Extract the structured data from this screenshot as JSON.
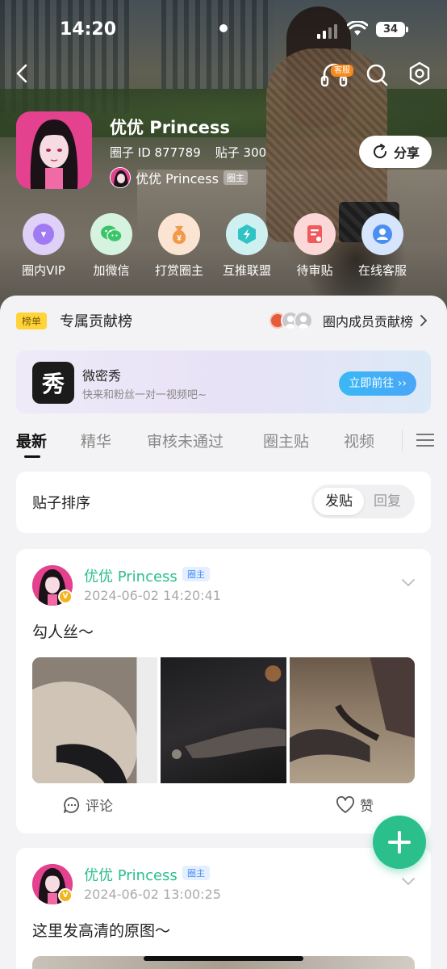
{
  "status_bar": {
    "time": "14:20",
    "battery": "34"
  },
  "nav": {
    "headset_badge": "客服"
  },
  "profile": {
    "name": "优优 Princess",
    "circle_id": "圈子 ID 877789",
    "posts": "贴子 300",
    "owner_name": "优优 Princess",
    "owner_tag": "圈主",
    "share_label": "分享"
  },
  "actions": [
    {
      "label": "圈内VIP",
      "icon": "vip-icon",
      "bg": "#d9c8f5",
      "fg": "#9a6ef0"
    },
    {
      "label": "加微信",
      "icon": "wechat-icon",
      "bg": "#d3f2dc",
      "fg": "#3cc46b"
    },
    {
      "label": "打赏圈主",
      "icon": "reward-icon",
      "bg": "#fbe3cf",
      "fg": "#f39a4a"
    },
    {
      "label": "互推联盟",
      "icon": "alliance-icon",
      "bg": "#cdeff0",
      "fg": "#2fc3c5"
    },
    {
      "label": "待审贴",
      "icon": "review-icon",
      "bg": "#fbd5d5",
      "fg": "#f05a5a"
    },
    {
      "label": "在线客服",
      "icon": "support-icon",
      "bg": "#d4e4fb",
      "fg": "#4a8ef0"
    }
  ],
  "ranking": {
    "badge": "榜单",
    "title": "专属贡献榜",
    "right_label": "圈内成员贡献榜"
  },
  "promo": {
    "logo_text": "秀",
    "title": "微密秀",
    "subtitle": "快来和粉丝一对一视频吧~",
    "button": "立即前往 ››"
  },
  "tabs": [
    "最新",
    "精华",
    "审核未通过",
    "圈主贴",
    "视频"
  ],
  "sort": {
    "label": "贴子排序",
    "option_on": "发贴",
    "option_off": "回复"
  },
  "posts": [
    {
      "author": "优优 Princess",
      "tag": "圈主",
      "time": "2024-06-02 14:20:41",
      "text": "勾人丝～",
      "comment_label": "评论",
      "like_label": "赞"
    },
    {
      "author": "优优 Princess",
      "tag": "圈主",
      "time": "2024-06-02 13:00:25",
      "text": "这里发高清的原图～"
    }
  ],
  "colors": {
    "accent": "#2bbf8c",
    "tag_blue": "#4b8ef5",
    "rank_yellow": "#ffd43b"
  }
}
